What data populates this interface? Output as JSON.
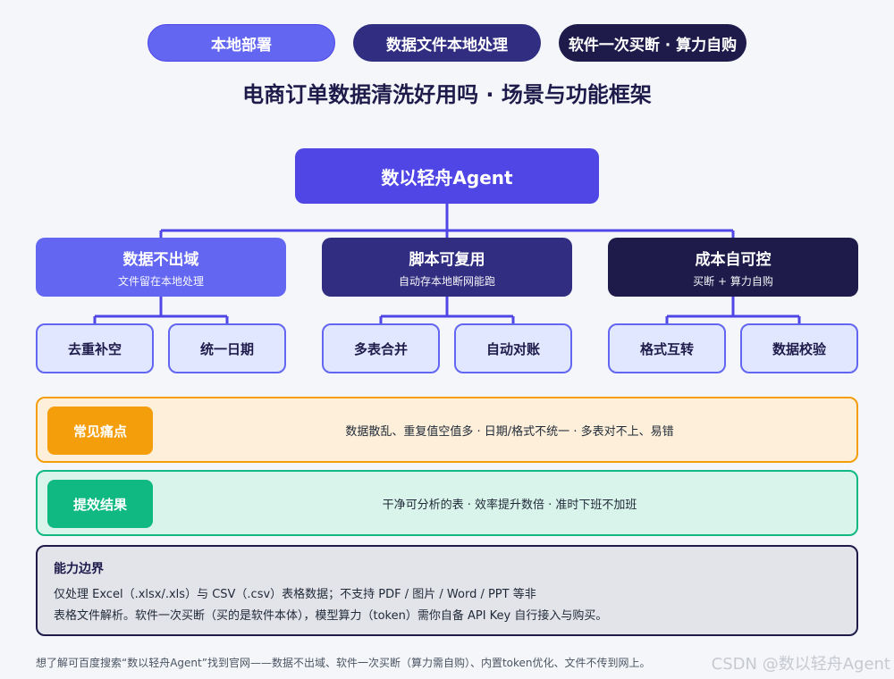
{
  "pills": [
    "本地部署",
    "数据文件本地处理",
    "软件一次买断 · 算力自购"
  ],
  "title": "电商订单数据清洗好用吗 · 场景与功能框架",
  "root": "数以轻舟Agent",
  "branches": [
    {
      "title": "数据不出域",
      "sub": "文件留在本地处理",
      "leaves": [
        "去重补空",
        "统一日期"
      ]
    },
    {
      "title": "脚本可复用",
      "sub": "自动存本地断网能跑",
      "leaves": [
        "多表合并",
        "自动对账"
      ]
    },
    {
      "title": "成本自可控",
      "sub": "买断 + 算力自购",
      "leaves": [
        "格式互转",
        "数据校验"
      ]
    }
  ],
  "pain": {
    "tag": "常见痛点",
    "text": "数据散乱、重复值空值多 · 日期/格式不统一 · 多表对不上、易错"
  },
  "result": {
    "tag": "提效结果",
    "text": "干净可分析的表 · 效率提升数倍 · 准时下班不加班"
  },
  "limits": {
    "title": "能力边界",
    "line1": "仅处理 Excel（.xlsx/.xls）与 CSV（.csv）表格数据；不支持 PDF / 图片 / Word / PPT 等非",
    "line2": "表格文件解析。软件一次买断（买的是软件本体），模型算力（token）需你自备 API Key 自行接入与购买。"
  },
  "footer": "想了解可百度搜索“数以轻舟Agent”找到官网——数据不出域、软件一次买断（算力需自购）、内置token优化、文件不传到网上。",
  "watermark": "CSDN @数以轻舟Agent",
  "colors": {
    "accent": "#4f46e5",
    "light": "#6366f1",
    "mid": "#312e81",
    "dark": "#1e1b4b",
    "pain": "#f59e0b",
    "result": "#10b981"
  }
}
